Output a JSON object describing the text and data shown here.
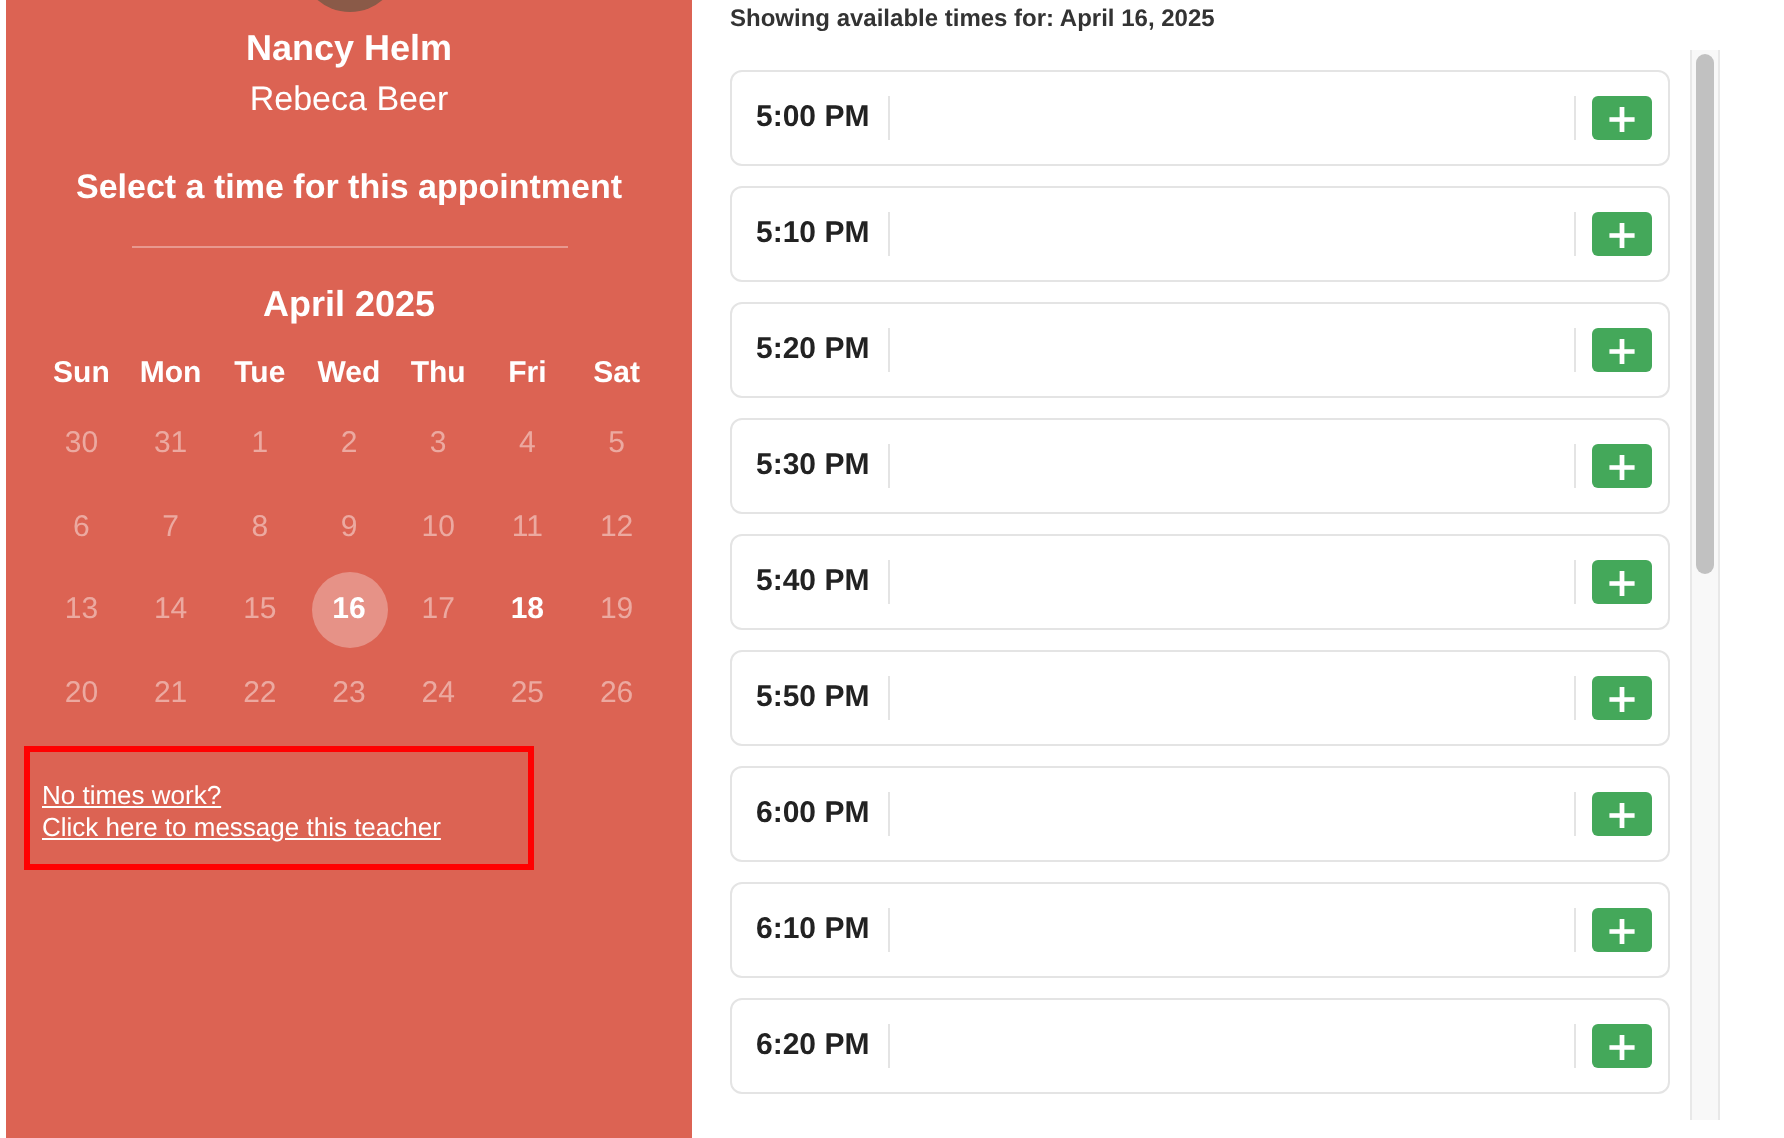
{
  "teacher": {
    "name": "Nancy Helm",
    "student": "Rebeca Beer"
  },
  "prompt": "Select a time for this appointment",
  "calendar": {
    "month": "April 2025",
    "weekdays": [
      "Sun",
      "Mon",
      "Tue",
      "Wed",
      "Thu",
      "Fri",
      "Sat"
    ],
    "days": [
      {
        "label": "30",
        "available": false,
        "selected": false
      },
      {
        "label": "31",
        "available": false,
        "selected": false
      },
      {
        "label": "1",
        "available": false,
        "selected": false
      },
      {
        "label": "2",
        "available": false,
        "selected": false
      },
      {
        "label": "3",
        "available": false,
        "selected": false
      },
      {
        "label": "4",
        "available": false,
        "selected": false
      },
      {
        "label": "5",
        "available": false,
        "selected": false
      },
      {
        "label": "6",
        "available": false,
        "selected": false
      },
      {
        "label": "7",
        "available": false,
        "selected": false
      },
      {
        "label": "8",
        "available": false,
        "selected": false
      },
      {
        "label": "9",
        "available": false,
        "selected": false
      },
      {
        "label": "10",
        "available": false,
        "selected": false
      },
      {
        "label": "11",
        "available": false,
        "selected": false
      },
      {
        "label": "12",
        "available": false,
        "selected": false
      },
      {
        "label": "13",
        "available": false,
        "selected": false
      },
      {
        "label": "14",
        "available": false,
        "selected": false
      },
      {
        "label": "15",
        "available": false,
        "selected": false
      },
      {
        "label": "16",
        "available": true,
        "selected": true
      },
      {
        "label": "17",
        "available": false,
        "selected": false
      },
      {
        "label": "18",
        "available": true,
        "selected": false
      },
      {
        "label": "19",
        "available": false,
        "selected": false
      },
      {
        "label": "20",
        "available": false,
        "selected": false
      },
      {
        "label": "21",
        "available": false,
        "selected": false
      },
      {
        "label": "22",
        "available": false,
        "selected": false
      },
      {
        "label": "23",
        "available": false,
        "selected": false
      },
      {
        "label": "24",
        "available": false,
        "selected": false
      },
      {
        "label": "25",
        "available": false,
        "selected": false
      },
      {
        "label": "26",
        "available": false,
        "selected": false
      }
    ]
  },
  "message_link": {
    "question": "No times work?",
    "action": "Click here to message this teacher"
  },
  "heading": "Showing available times for: April 16, 2025",
  "slots": [
    {
      "time": "5:00 PM",
      "add": "+"
    },
    {
      "time": "5:10 PM",
      "add": "+"
    },
    {
      "time": "5:20 PM",
      "add": "+"
    },
    {
      "time": "5:30 PM",
      "add": "+"
    },
    {
      "time": "5:40 PM",
      "add": "+"
    },
    {
      "time": "5:50 PM",
      "add": "+"
    },
    {
      "time": "6:00 PM",
      "add": "+"
    },
    {
      "time": "6:10 PM",
      "add": "+"
    },
    {
      "time": "6:20 PM",
      "add": "+"
    }
  ]
}
